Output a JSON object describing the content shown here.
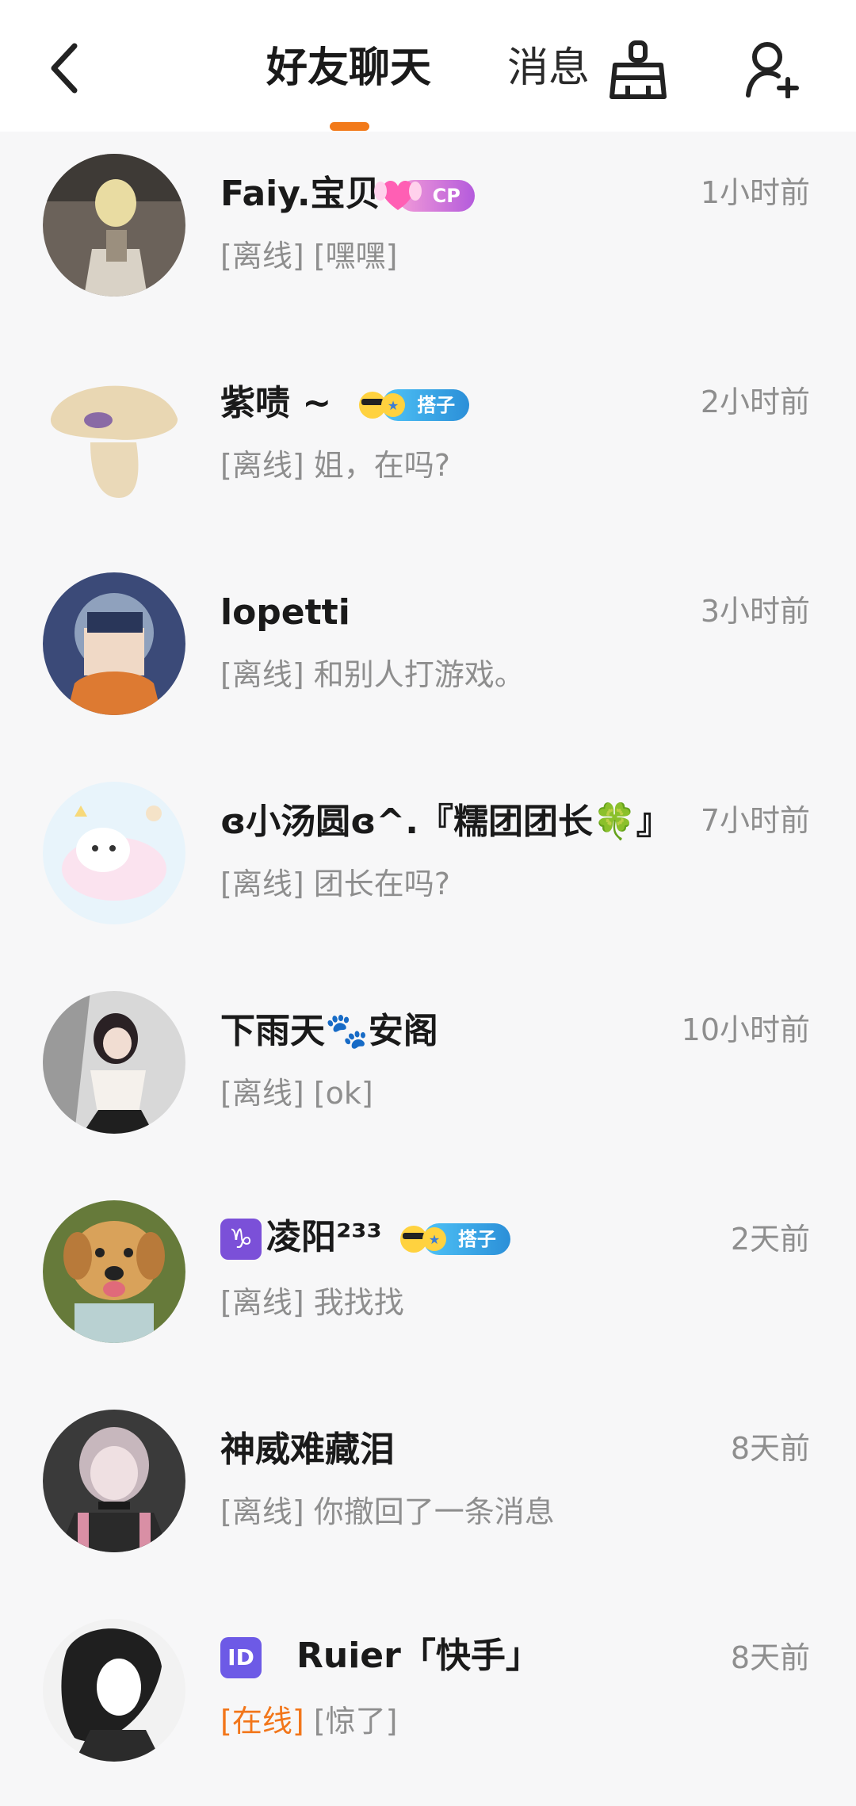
{
  "header": {
    "tabs": [
      {
        "label": "好友聊天",
        "active": true
      },
      {
        "label": "消息",
        "active": false
      }
    ],
    "icons": [
      "back-icon",
      "clean-icon",
      "add-friend-icon"
    ],
    "accent_color": "#f27a1a"
  },
  "chats": [
    {
      "name": "Faiy.宝贝",
      "badge": "CP",
      "time": "1小时前",
      "status": "[离线]",
      "message": "[嘿嘿]"
    },
    {
      "name": "紫啧 ~",
      "badge": "搭子",
      "time": "2小时前",
      "status": "[离线]",
      "message": "姐，在吗?"
    },
    {
      "name": "lopetti",
      "badge": "",
      "time": "3小时前",
      "status": "[离线]",
      "message": "和别人打游戏。"
    },
    {
      "name": "ɞ小汤圆ɞ^.『糯团团长🍀』",
      "badge": "",
      "time": "7小时前",
      "status": "[离线]",
      "message": "团长在吗?"
    },
    {
      "name": "下雨天🐾安阁",
      "badge": "",
      "time": "10小时前",
      "status": "[离线]",
      "message": "[ok]"
    },
    {
      "name": "凌阳²³³",
      "sign": "♑",
      "badge": "搭子",
      "time": "2天前",
      "status": "[离线]",
      "message": "我找找"
    },
    {
      "name": "神威难藏泪",
      "badge": "",
      "time": "8天前",
      "status": "[离线]",
      "message": "你撤回了一条消息"
    },
    {
      "name": "Ruier「快手」",
      "id_icon": "ID",
      "badge": "",
      "time": "8天前",
      "status": "[在线]",
      "message": "[惊了]"
    }
  ]
}
